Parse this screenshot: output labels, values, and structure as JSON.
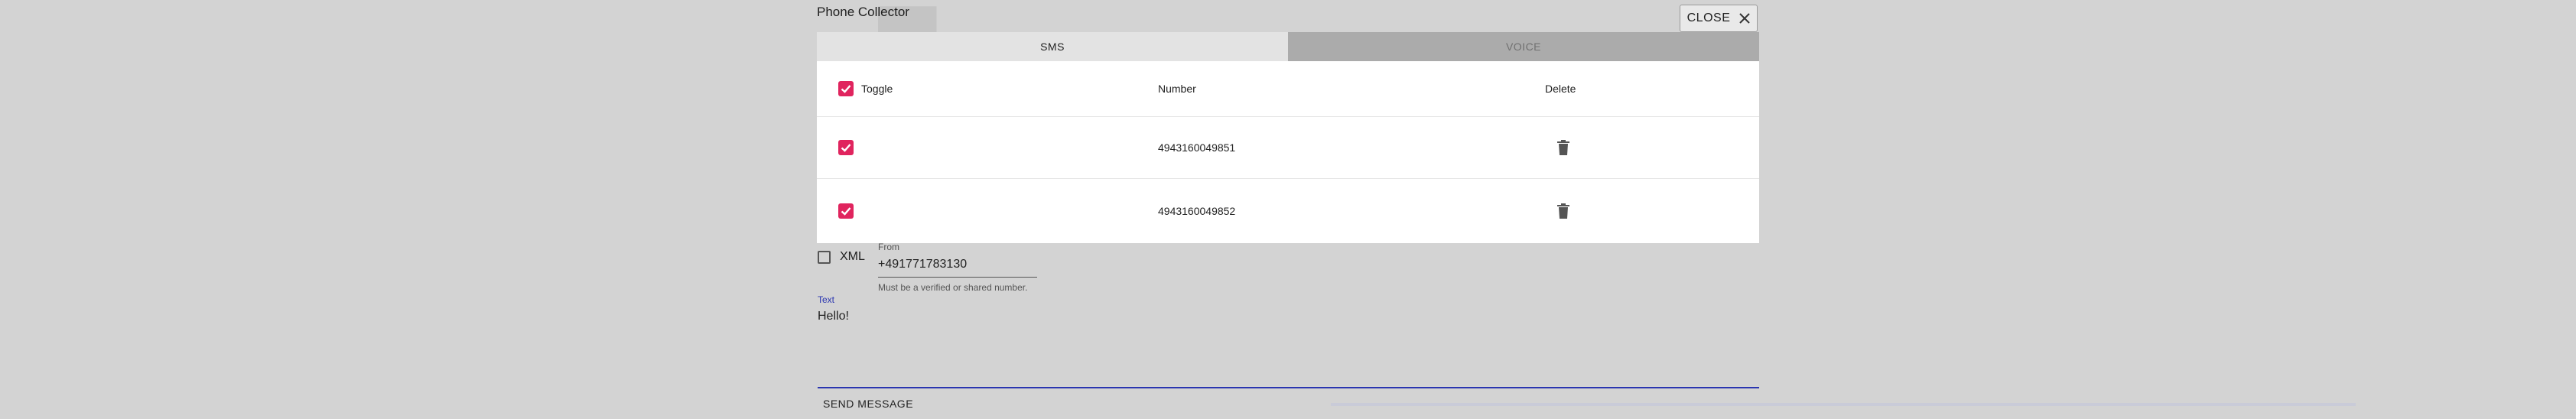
{
  "dialog": {
    "title": "Phone Collector",
    "close_label": "CLOSE",
    "tabs": [
      {
        "label": "SMS",
        "active": true
      },
      {
        "label": "VOICE",
        "active": false
      }
    ],
    "table": {
      "headers": {
        "toggle": "Toggle",
        "number": "Number",
        "delete": "Delete"
      },
      "rows": [
        {
          "checked": true,
          "number": "4943160049851"
        },
        {
          "checked": true,
          "number": "4943160049852"
        }
      ]
    }
  },
  "form": {
    "xml_label": "XML",
    "from_label": "From",
    "from_value": "+491771783130",
    "from_help": "Must be a verified or shared number.",
    "text_label": "Text",
    "text_value": "Hello!",
    "send_label": "SEND MESSAGE"
  },
  "colors": {
    "accent": "#e0245e",
    "focus": "#2a35b0",
    "overlay": "#d3d3d3"
  },
  "icons": {
    "close": "close-icon",
    "checkbox": "checkbox-checked-icon",
    "delete": "trash-icon"
  }
}
